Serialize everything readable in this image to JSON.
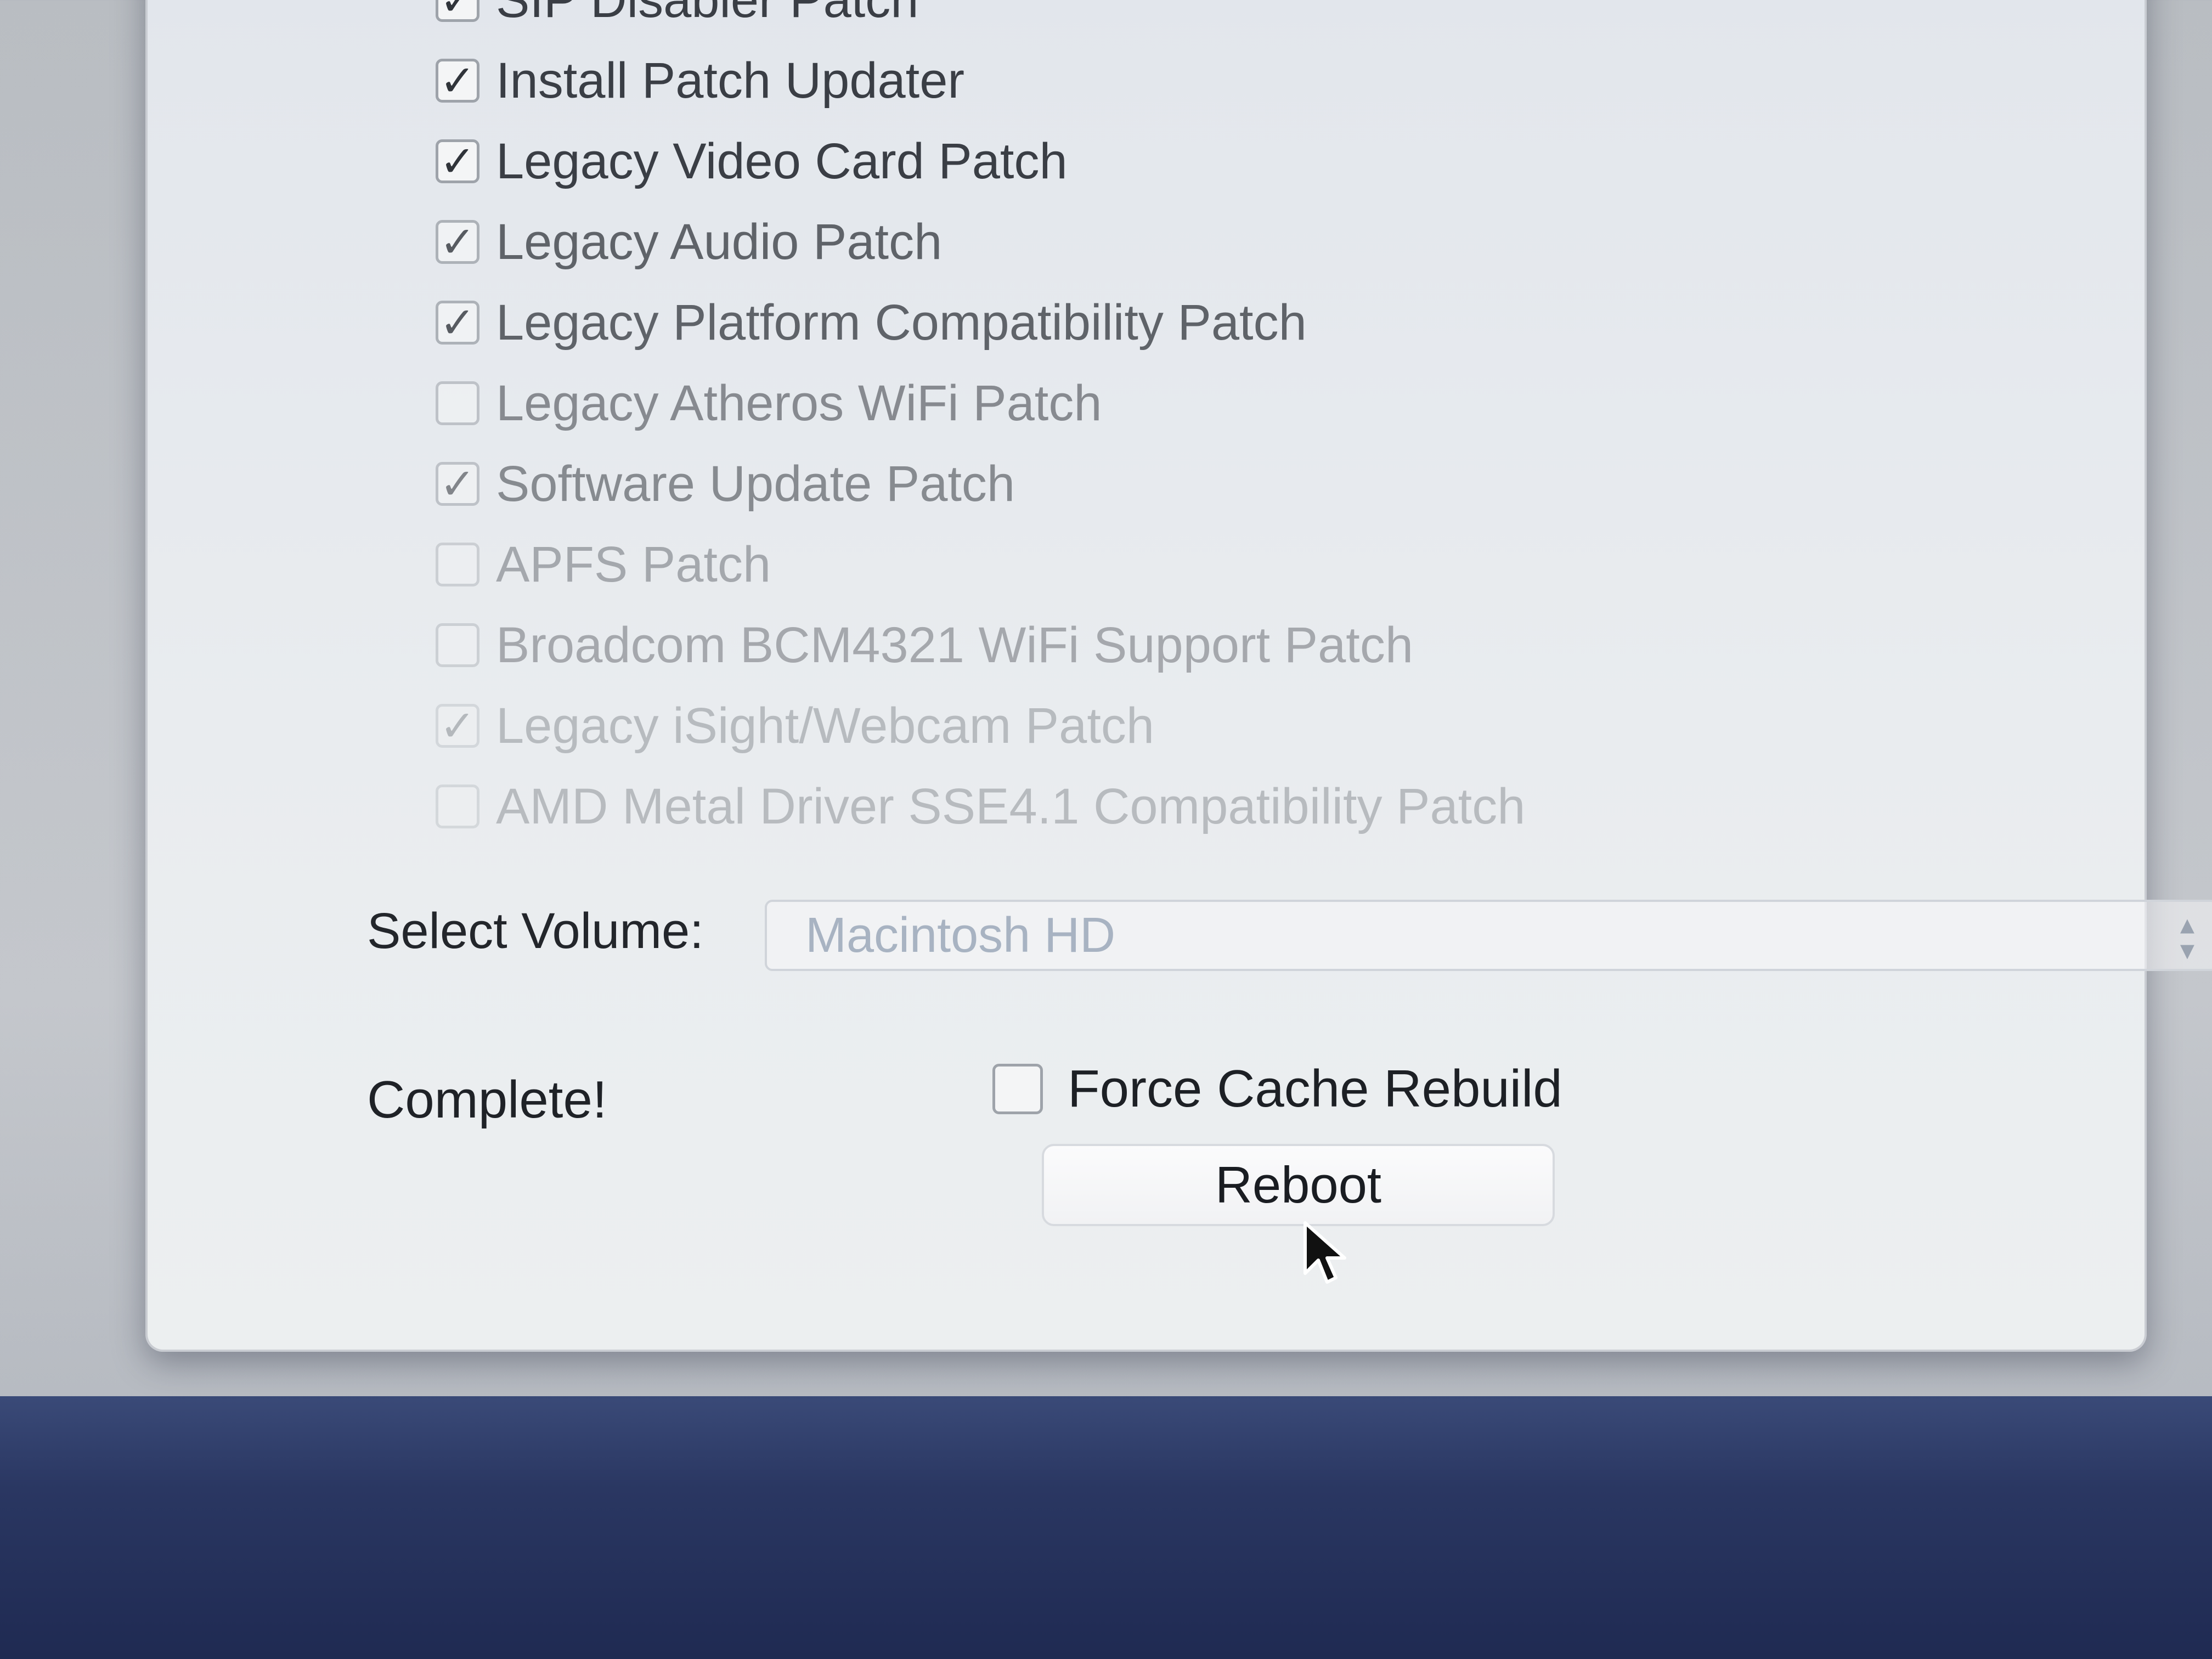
{
  "patches": [
    {
      "label": "SIP Disabler Patch",
      "checked": "✓"
    },
    {
      "label": "Install Patch Updater",
      "checked": "✓"
    },
    {
      "label": "Legacy Video Card Patch",
      "checked": "✓"
    },
    {
      "label": "Legacy Audio Patch",
      "checked": "✓"
    },
    {
      "label": "Legacy Platform Compatibility Patch",
      "checked": "✓"
    },
    {
      "label": "Legacy Atheros WiFi Patch",
      "checked": ""
    },
    {
      "label": "Software Update Patch",
      "checked": "✓"
    },
    {
      "label": "APFS Patch",
      "checked": ""
    },
    {
      "label": "Broadcom BCM4321 WiFi Support Patch",
      "checked": ""
    },
    {
      "label": "Legacy iSight/Webcam Patch",
      "checked": "✓"
    },
    {
      "label": "AMD Metal Driver SSE4.1 Compatibility Patch",
      "checked": ""
    }
  ],
  "volume": {
    "label": "Select Volume:",
    "selected": "Macintosh HD"
  },
  "status": "Complete!",
  "force_cache": {
    "label": "Force Cache Rebuild",
    "checked": ""
  },
  "reboot_label": "Reboot",
  "icons": {
    "check": "checkmark-icon",
    "select": "chevron-up-down-icon",
    "cursor": "mouse-pointer-icon"
  }
}
